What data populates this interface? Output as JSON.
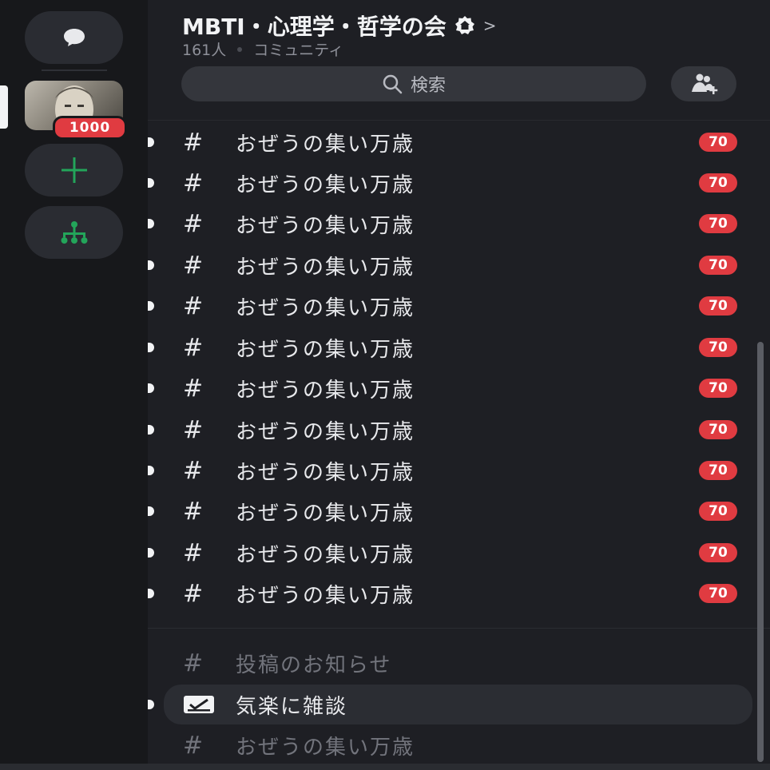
{
  "server": {
    "name": "MBTI・心理学・哲学の会",
    "member_count": "161人",
    "type": "コミュニティ",
    "notification_badge": "1000"
  },
  "search": {
    "placeholder": "検索"
  },
  "channels": [
    {
      "name": "おぜうの集い万歳",
      "badge": "70",
      "unread": true
    },
    {
      "name": "おぜうの集い万歳",
      "badge": "70",
      "unread": true
    },
    {
      "name": "おぜうの集い万歳",
      "badge": "70",
      "unread": true
    },
    {
      "name": "おぜうの集い万歳",
      "badge": "70",
      "unread": true
    },
    {
      "name": "おぜうの集い万歳",
      "badge": "70",
      "unread": true
    },
    {
      "name": "おぜうの集い万歳",
      "badge": "70",
      "unread": true
    },
    {
      "name": "おぜうの集い万歳",
      "badge": "70",
      "unread": true
    },
    {
      "name": "おぜうの集い万歳",
      "badge": "70",
      "unread": true
    },
    {
      "name": "おぜうの集い万歳",
      "badge": "70",
      "unread": true
    },
    {
      "name": "おぜうの集い万歳",
      "badge": "70",
      "unread": true
    },
    {
      "name": "おぜうの集い万歳",
      "badge": "70",
      "unread": true
    },
    {
      "name": "おぜうの集い万歳",
      "badge": "70",
      "unread": true
    }
  ],
  "lower_channels": [
    {
      "name": "投稿のお知らせ",
      "icon": "hash-icon"
    },
    {
      "name": "気楽に雑談",
      "icon": "forum-icon"
    },
    {
      "name": "おぜうの集い万歳",
      "icon": "hash-icon"
    }
  ],
  "colors": {
    "badge": "#e03b41",
    "accent_green": "#23a55a"
  }
}
